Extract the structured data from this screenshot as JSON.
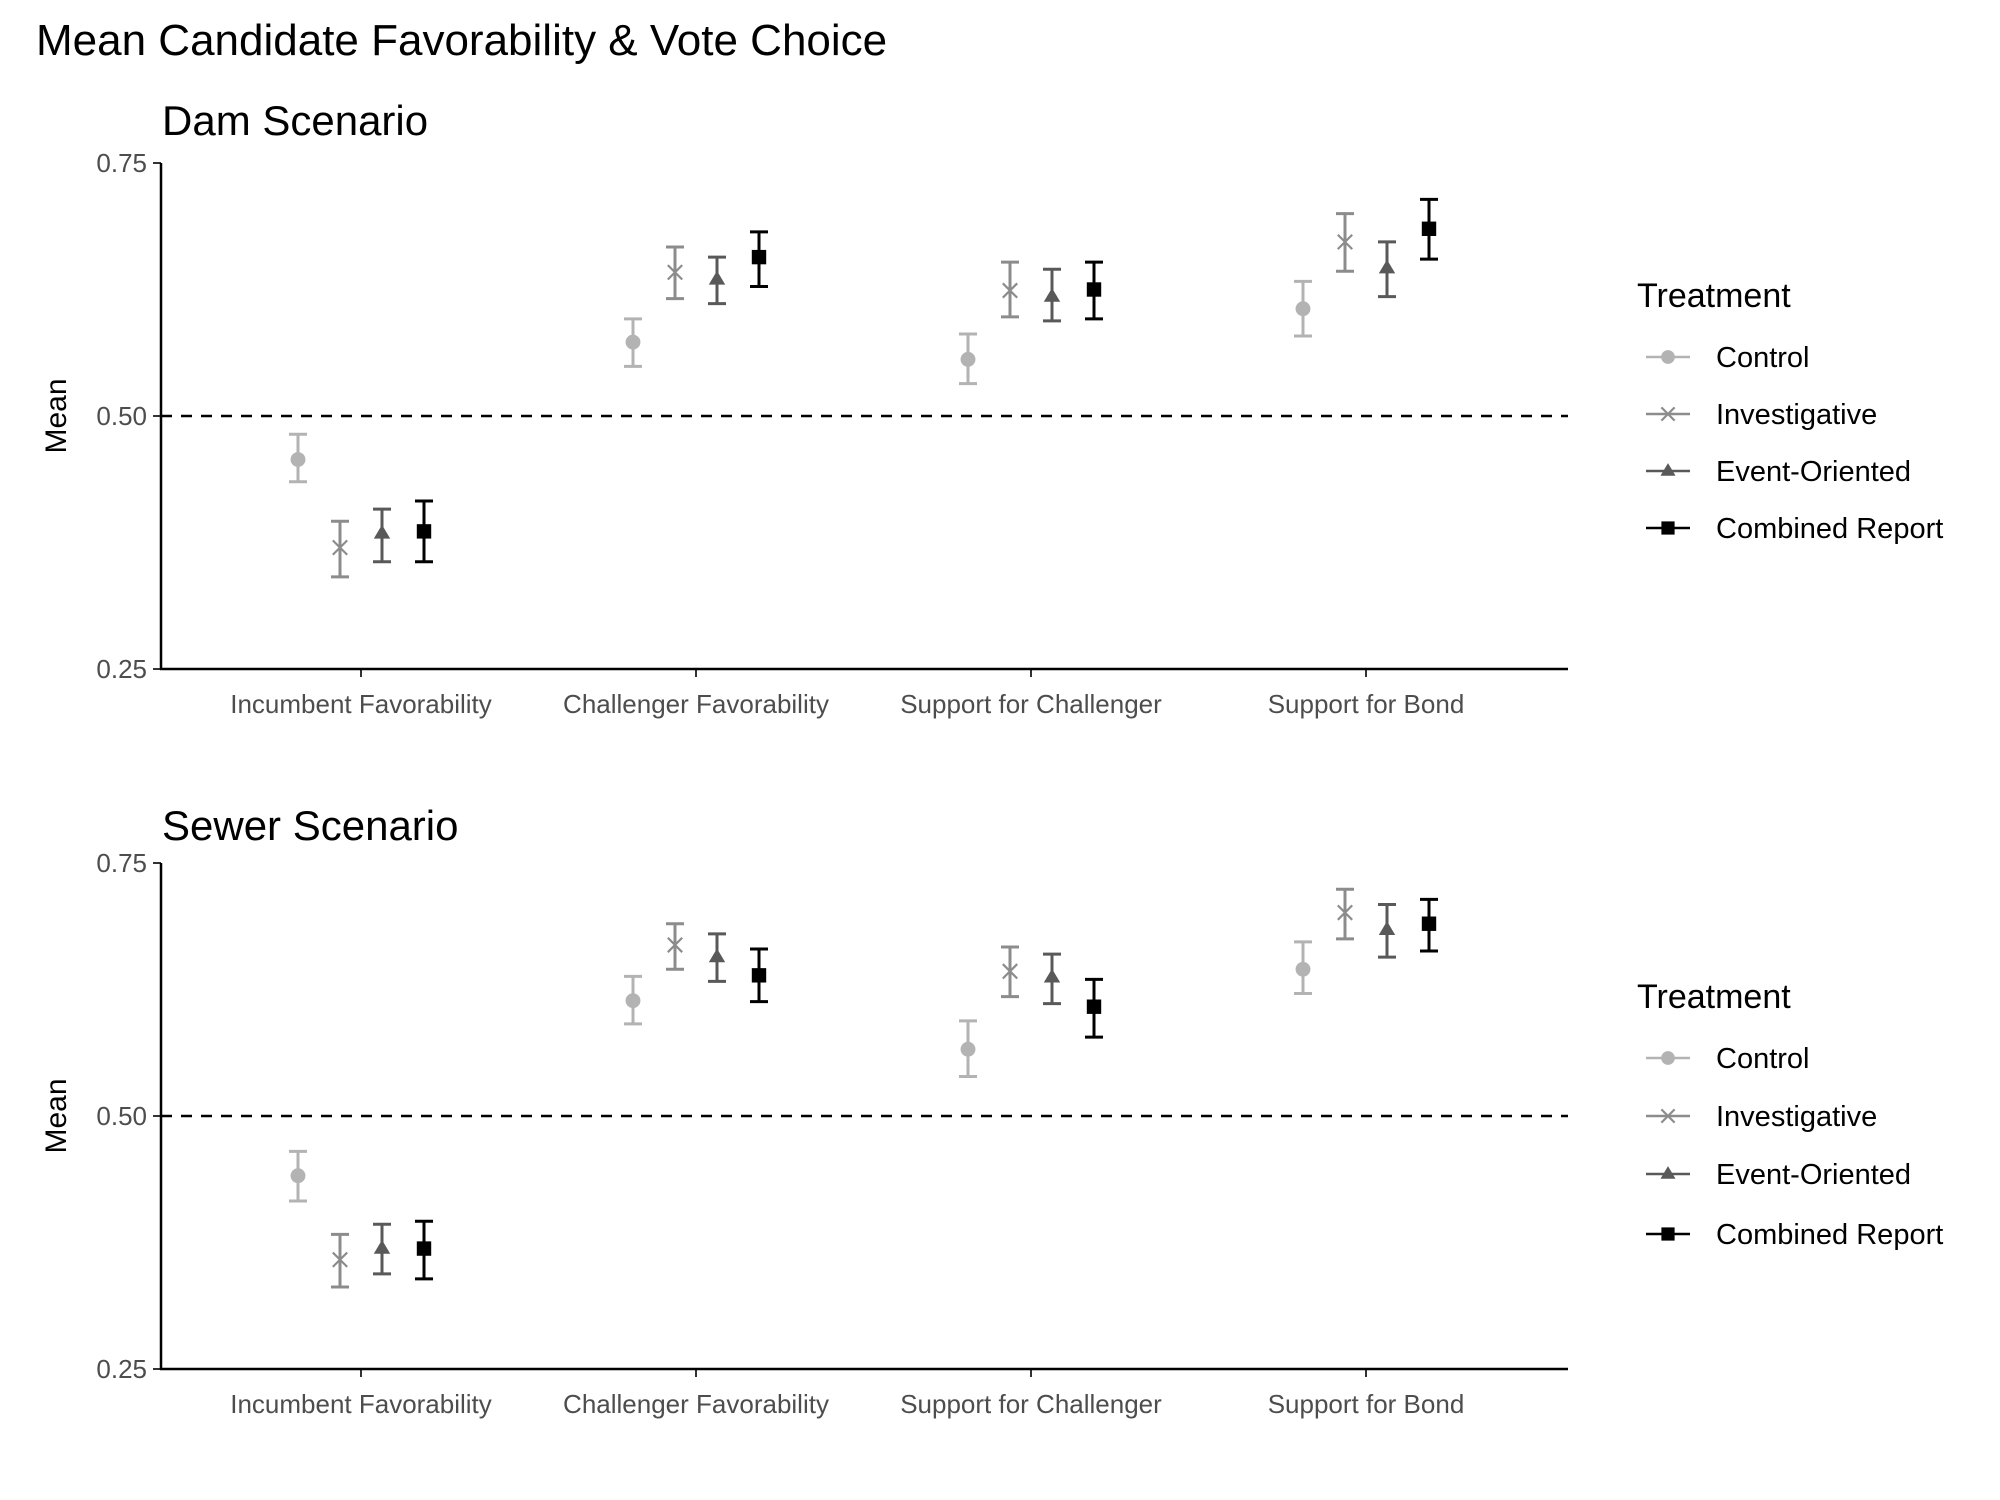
{
  "chart_data": {
    "type": "scatter",
    "subtype": "point-with-error-bars",
    "title": "Mean Candidate Favorability & Vote Choice",
    "legend": {
      "title": "Treatment",
      "placement": "right",
      "entries": [
        {
          "name": "Control",
          "marker": "circle",
          "color": "#b3b3b3"
        },
        {
          "name": "Investigative",
          "marker": "x",
          "color": "#8c8c8c"
        },
        {
          "name": "Event-Oriented",
          "marker": "triangle",
          "color": "#595959"
        },
        {
          "name": "Combined Report",
          "marker": "square",
          "color": "#000000"
        }
      ]
    },
    "reference_line": {
      "y": 0.5,
      "style": "dashed"
    },
    "panels": [
      {
        "title": "Dam Scenario",
        "xlabel": "",
        "ylabel": "Mean",
        "ylim": [
          0.25,
          0.75
        ],
        "yticks": [
          "0.25",
          "0.50",
          "0.75"
        ],
        "ytick_values": [
          0.25,
          0.5,
          0.75
        ],
        "categories": [
          "Incumbent Favorability",
          "Challenger Favorability",
          "Support for Challenger",
          "Support for Bond"
        ],
        "series": [
          {
            "name": "Control",
            "values": [
              0.457,
              0.573,
              0.556,
              0.606
            ],
            "lower": [
              0.435,
              0.549,
              0.532,
              0.579
            ],
            "upper": [
              0.482,
              0.596,
              0.581,
              0.633
            ]
          },
          {
            "name": "Investigative",
            "values": [
              0.37,
              0.642,
              0.624,
              0.672
            ],
            "lower": [
              0.341,
              0.616,
              0.598,
              0.643
            ],
            "upper": [
              0.396,
              0.667,
              0.652,
              0.7
            ]
          },
          {
            "name": "Event-Oriented",
            "values": [
              0.384,
              0.635,
              0.618,
              0.646
            ],
            "lower": [
              0.356,
              0.611,
              0.594,
              0.618
            ],
            "upper": [
              0.408,
              0.657,
              0.645,
              0.672
            ]
          },
          {
            "name": "Combined Report",
            "values": [
              0.386,
              0.657,
              0.625,
              0.685
            ],
            "lower": [
              0.356,
              0.628,
              0.596,
              0.655
            ],
            "upper": [
              0.416,
              0.682,
              0.652,
              0.714
            ]
          }
        ]
      },
      {
        "title": "Sewer Scenario",
        "xlabel": "",
        "ylabel": "Mean",
        "ylim": [
          0.25,
          0.75
        ],
        "yticks": [
          "0.25",
          "0.50",
          "0.75"
        ],
        "ytick_values": [
          0.25,
          0.5,
          0.75
        ],
        "categories": [
          "Incumbent Favorability",
          "Challenger Favorability",
          "Support for Challenger",
          "Support for Bond"
        ],
        "series": [
          {
            "name": "Control",
            "values": [
              0.441,
              0.614,
              0.566,
              0.645
            ],
            "lower": [
              0.416,
              0.591,
              0.539,
              0.621
            ],
            "upper": [
              0.465,
              0.638,
              0.594,
              0.672
            ]
          },
          {
            "name": "Investigative",
            "values": [
              0.358,
              0.669,
              0.643,
              0.701
            ],
            "lower": [
              0.331,
              0.645,
              0.618,
              0.675
            ],
            "upper": [
              0.383,
              0.69,
              0.667,
              0.724
            ]
          },
          {
            "name": "Event-Oriented",
            "values": [
              0.369,
              0.657,
              0.637,
              0.684
            ],
            "lower": [
              0.344,
              0.633,
              0.611,
              0.657
            ],
            "upper": [
              0.393,
              0.68,
              0.66,
              0.709
            ]
          },
          {
            "name": "Combined Report",
            "values": [
              0.369,
              0.639,
              0.608,
              0.69
            ],
            "lower": [
              0.339,
              0.613,
              0.578,
              0.663
            ],
            "upper": [
              0.396,
              0.665,
              0.635,
              0.714
            ]
          }
        ]
      }
    ]
  }
}
